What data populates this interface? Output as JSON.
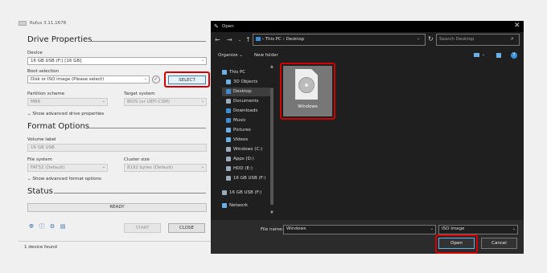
{
  "rufus": {
    "title": "Rufus 3.11.1678",
    "drive_properties": "Drive Properties",
    "device_label": "Device",
    "device_value": "16 GB USB (F:) [16 GB]",
    "boot_label": "Boot selection",
    "boot_value": "Disk or ISO image (Please select)",
    "select_button": "SELECT",
    "partition_label": "Partition scheme",
    "partition_value": "MBR",
    "target_label": "Target system",
    "target_value": "BIOS (or UEFI-CSM)",
    "adv_drive": "Show advanced drive properties",
    "format_options": "Format Options",
    "volume_label": "Volume label",
    "volume_value": "16 GB USB",
    "fs_label": "File system",
    "fs_value": "FAT32 (Default)",
    "cluster_label": "Cluster size",
    "cluster_value": "8192 bytes (Default)",
    "adv_format": "Show advanced format options",
    "status": "Status",
    "ready": "READY",
    "start_button": "START",
    "close_button": "CLOSE",
    "footer": "1 device found"
  },
  "dialog": {
    "title": "Open",
    "breadcrumb_root": "This PC",
    "breadcrumb_current": "Desktop",
    "search_placeholder": "Search Desktop",
    "organize": "Organize",
    "new_folder": "New folder",
    "nav_items": [
      {
        "label": "This PC",
        "icon": "pc-icon",
        "color": "#6ab0e8"
      },
      {
        "label": "3D Objects",
        "icon": "cube-icon",
        "color": "#6ab0e8"
      },
      {
        "label": "Desktop",
        "icon": "desktop-icon",
        "color": "#3a8fd8"
      },
      {
        "label": "Documents",
        "icon": "documents-icon",
        "color": "#9ab"
      },
      {
        "label": "Downloads",
        "icon": "downloads-icon",
        "color": "#3a8fd8"
      },
      {
        "label": "Music",
        "icon": "music-icon",
        "color": "#3a8fd8"
      },
      {
        "label": "Pictures",
        "icon": "pictures-icon",
        "color": "#6ab0e8"
      },
      {
        "label": "Videos",
        "icon": "videos-icon",
        "color": "#6ab0e8"
      },
      {
        "label": "Windows (C:)",
        "icon": "drive-icon",
        "color": "#9ab"
      },
      {
        "label": "Apps (D:)",
        "icon": "drive-icon",
        "color": "#9ab"
      },
      {
        "label": "HDD (E:)",
        "icon": "drive-icon",
        "color": "#9ab"
      },
      {
        "label": "16 GB USB (F:)",
        "icon": "usb-drive-icon",
        "color": "#9ab"
      },
      {
        "label": "16 GB USB (F:)",
        "icon": "usb-drive-icon",
        "color": "#9ab"
      },
      {
        "label": "Network",
        "icon": "network-icon",
        "color": "#6ab0e8"
      }
    ],
    "file_item": "Windows",
    "filename_label": "File name:",
    "filename_value": "Windows",
    "filetype_value": "ISO Image",
    "open_button": "Open",
    "cancel_button": "Cancel",
    "accent_red": "#d40000"
  }
}
